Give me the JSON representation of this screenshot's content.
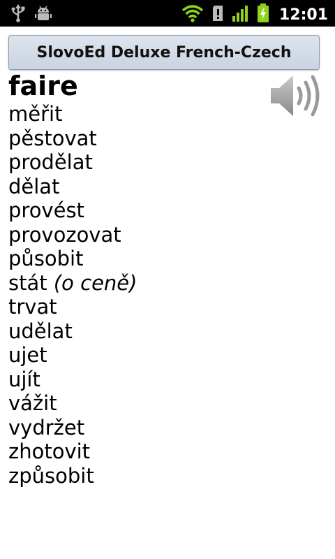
{
  "status_bar": {
    "time": "12:01",
    "icons": [
      "usb-icon",
      "android-debug-icon",
      "wifi-icon",
      "sd-card-alert-icon",
      "signal-icon",
      "battery-charging-icon"
    ]
  },
  "app": {
    "title": "SlovoEd Deluxe French-Czech"
  },
  "entry": {
    "headword": "faire",
    "translations": [
      {
        "word": "měřit",
        "note": ""
      },
      {
        "word": "pěstovat",
        "note": ""
      },
      {
        "word": "prodělat",
        "note": ""
      },
      {
        "word": "dělat",
        "note": ""
      },
      {
        "word": "provést",
        "note": ""
      },
      {
        "word": "provozovat",
        "note": ""
      },
      {
        "word": "působit",
        "note": ""
      },
      {
        "word": "stát",
        "note": "(o ceně)"
      },
      {
        "word": "trvat",
        "note": ""
      },
      {
        "word": "udělat",
        "note": ""
      },
      {
        "word": "ujet",
        "note": ""
      },
      {
        "word": "ujít",
        "note": ""
      },
      {
        "word": "vážit",
        "note": ""
      },
      {
        "word": "vydržet",
        "note": ""
      },
      {
        "word": "zhotovit",
        "note": ""
      },
      {
        "word": "způsobit",
        "note": ""
      }
    ]
  },
  "speaker": {
    "icon": "speaker-icon"
  }
}
